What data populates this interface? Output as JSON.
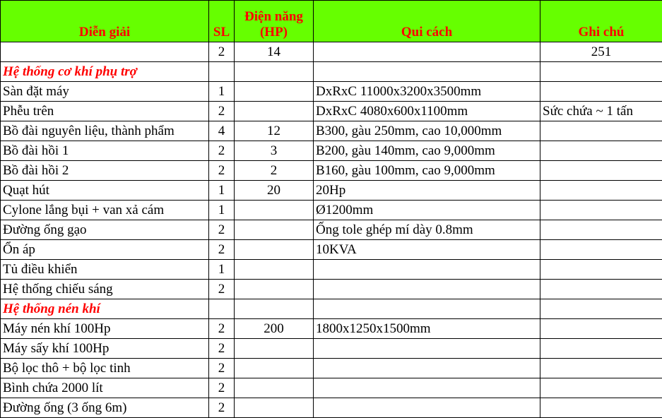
{
  "headers": {
    "description": "Diễn giải",
    "qty": "SL",
    "power_line1": "Điện năng",
    "power_line2": "(HP)",
    "spec": "Qui cách",
    "note": "Ghi chú"
  },
  "colors": {
    "header_bg": "#66ff00",
    "header_text": "#ff0000",
    "section_text": "#ff0000"
  },
  "rows": [
    {
      "type": "data",
      "desc": "",
      "qty": "2",
      "power": "14",
      "spec": "",
      "note": "251"
    },
    {
      "type": "section",
      "desc": "Hệ thống cơ khí phụ trợ",
      "qty": "",
      "power": "",
      "spec": "",
      "note": ""
    },
    {
      "type": "data",
      "desc": "Sàn đặt máy",
      "qty": "1",
      "power": "",
      "spec": "DxRxC 11000x3200x3500mm",
      "note": ""
    },
    {
      "type": "data",
      "desc": "Phễu trên",
      "qty": "2",
      "power": "",
      "spec": "DxRxC 4080x600x1100mm",
      "note": "Sức chứa ~ 1 tấn"
    },
    {
      "type": "data",
      "desc": "Bồ đài nguyên liệu, thành phẩm",
      "qty": "4",
      "power": "12",
      "spec": "B300, gàu 250mm, cao 10,000mm",
      "note": ""
    },
    {
      "type": "data",
      "desc": "Bồ đài hồi 1",
      "qty": "2",
      "power": "3",
      "spec": "B200, gàu 140mm, cao 9,000mm",
      "note": ""
    },
    {
      "type": "data",
      "desc": "Bồ đài hồi 2",
      "qty": "2",
      "power": "2",
      "spec": "B160, gàu 100mm, cao 9,000mm",
      "note": ""
    },
    {
      "type": "data",
      "desc": "Quạt hút",
      "qty": "1",
      "power": "20",
      "spec": "20Hp",
      "note": ""
    },
    {
      "type": "data",
      "desc": "Cylone lắng bụi + van xả cám",
      "qty": "1",
      "power": "",
      "spec": "Ø1200mm",
      "note": ""
    },
    {
      "type": "data",
      "desc": "Đường ống gạo",
      "qty": "2",
      "power": "",
      "spec": "Ống tole ghép mí dày 0.8mm",
      "note": ""
    },
    {
      "type": "data",
      "desc": "Ổn áp",
      "qty": "2",
      "power": "",
      "spec": "10KVA",
      "note": ""
    },
    {
      "type": "data",
      "desc": "Tủ điều khiển",
      "qty": "1",
      "power": "",
      "spec": "",
      "note": ""
    },
    {
      "type": "data",
      "desc": "Hệ thống chiếu sáng",
      "qty": "2",
      "power": "",
      "spec": "",
      "note": ""
    },
    {
      "type": "section",
      "desc": "Hệ thống nén khí",
      "qty": "",
      "power": "",
      "spec": "",
      "note": ""
    },
    {
      "type": "data",
      "desc": "Máy nén khí 100Hp",
      "qty": "2",
      "power": "200",
      "spec": "1800x1250x1500mm",
      "note": ""
    },
    {
      "type": "data",
      "desc": "Máy sấy khí 100Hp",
      "qty": "2",
      "power": "",
      "spec": "",
      "note": ""
    },
    {
      "type": "data",
      "desc": "Bộ lọc thô + bộ lọc tinh",
      "qty": "2",
      "power": "",
      "spec": "",
      "note": ""
    },
    {
      "type": "data",
      "desc": "Bình chứa 2000 lít",
      "qty": "2",
      "power": "",
      "spec": "",
      "note": ""
    },
    {
      "type": "data",
      "desc": "Đường ống (3 ống 6m)",
      "qty": "2",
      "power": "",
      "spec": "",
      "note": ""
    }
  ]
}
